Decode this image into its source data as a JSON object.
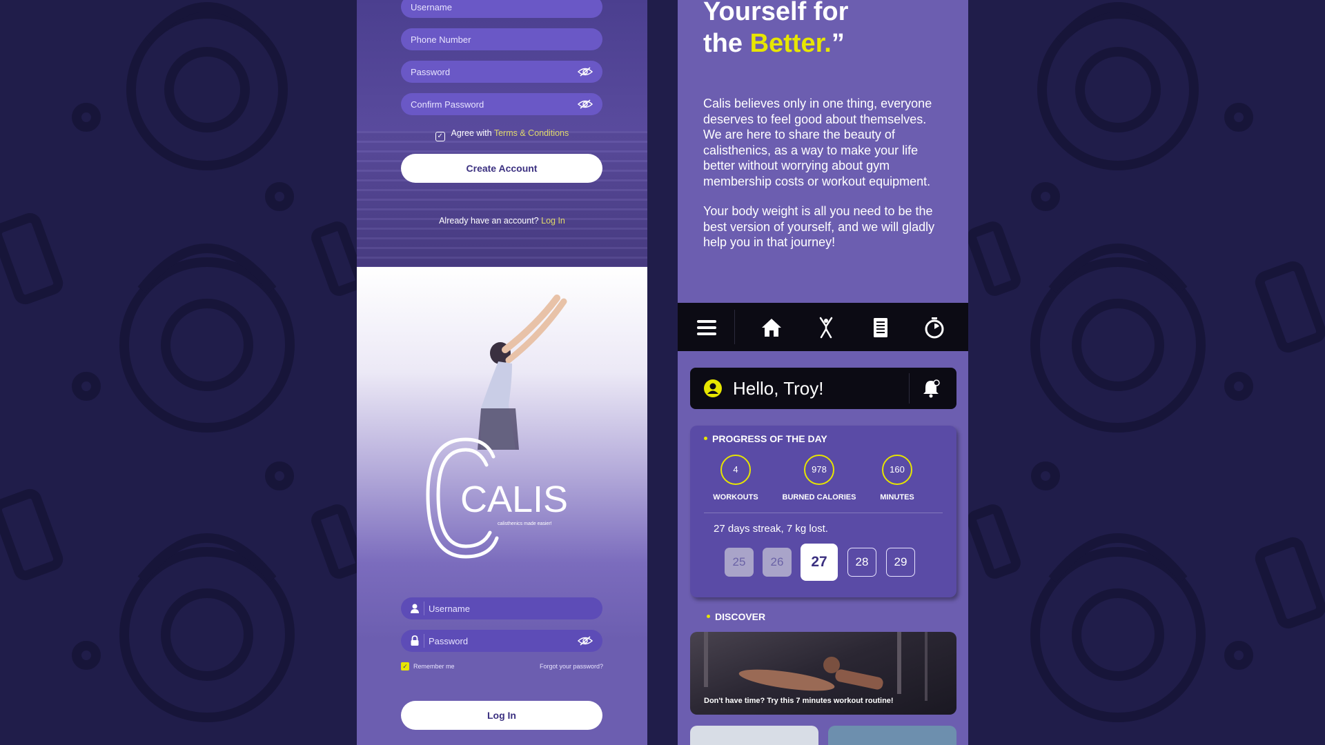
{
  "signup": {
    "username_placeholder": "Username",
    "phone_placeholder": "Phone Number",
    "password_placeholder": "Password",
    "confirm_placeholder": "Confirm Password",
    "agree_prefix": "Agree with",
    "terms_link": "Terms & Conditions",
    "create_button": "Create Account",
    "already_text": "Already have an account?",
    "login_link": "Log In"
  },
  "brand": {
    "logo_text": "CALIS",
    "tagline": "calisthenics made easier!"
  },
  "login": {
    "username_placeholder": "Username",
    "password_placeholder": "Password",
    "remember_label": "Remember me",
    "forgot_link": "Forgot your password?",
    "login_button": "Log In"
  },
  "about": {
    "quote_line1": "Yourself for",
    "quote_line2_prefix": "the",
    "quote_line2_accent": "Better.",
    "quote_line2_suffix": "”",
    "paragraph1": "Calis believes only in one thing, everyone deserves to feel good about themselves. We are here to share the beauty of calisthenics, as a way to make your life better without worrying about gym membership costs or workout equipment.",
    "paragraph2": "Your body weight is all you need to be the best version of yourself, and we will gladly help you in that journey!"
  },
  "nav": {
    "icons": [
      "menu-icon",
      "home-icon",
      "exercise-icon",
      "list-icon",
      "timer-icon"
    ]
  },
  "dashboard": {
    "greeting": "Hello, Troy!",
    "progress_title": "PROGRESS OF THE DAY",
    "stats": [
      {
        "value": "4",
        "label": "WORKOUTS"
      },
      {
        "value": "978",
        "label": "BURNED CALORIES"
      },
      {
        "value": "160",
        "label": "MINUTES"
      }
    ],
    "streak_text": "27 days streak, 7 kg lost.",
    "days": [
      "25",
      "26",
      "27",
      "28",
      "29"
    ],
    "discover_title": "DISCOVER",
    "discover_caption": "Don't have time? Try this 7 minutes workout routine!"
  },
  "colors": {
    "background": "#201d4a",
    "panel": "#6c5eb0",
    "accent": "#e7e600",
    "dark": "#0c0b14"
  }
}
